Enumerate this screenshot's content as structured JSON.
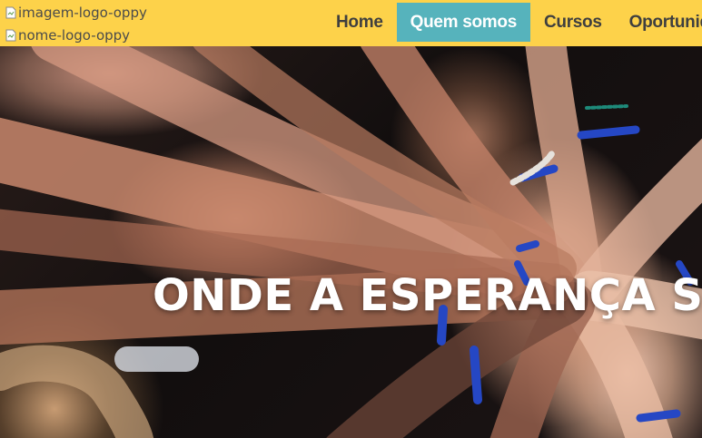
{
  "header": {
    "logo_image_alt": "imagem-logo-oppy",
    "logo_name_alt": "nome-logo-oppy",
    "background_color": "#fdd24a"
  },
  "nav": {
    "items": [
      {
        "label": "Home",
        "active": false
      },
      {
        "label": "Quem somos",
        "active": true
      },
      {
        "label": "Cursos",
        "active": false
      },
      {
        "label": "Oportunidades",
        "active": false
      }
    ],
    "active_color": "#56b3bc"
  },
  "hero": {
    "title": "ONDE A ESPERANÇA SE"
  }
}
